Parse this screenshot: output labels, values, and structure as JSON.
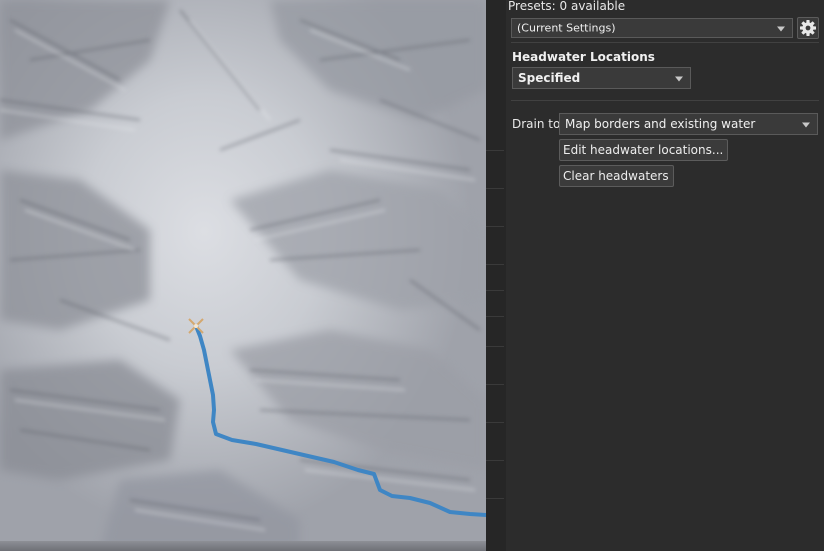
{
  "presets": {
    "label": "Presets: 0 available",
    "current": "(Current Settings)"
  },
  "headwater": {
    "heading": "Headwater Locations",
    "mode": "Specified"
  },
  "drain": {
    "label": "Drain to:",
    "value": "Map borders and existing water"
  },
  "buttons": {
    "edit": "Edit headwater locations...",
    "clear": "Clear headwaters"
  },
  "colors": {
    "river": "#3f86c4",
    "headwater_marker": "#d4a870",
    "panel_bg": "#2c2c2c"
  },
  "icons": {
    "settings": "gear-icon",
    "headwater": "x-marker-icon"
  }
}
